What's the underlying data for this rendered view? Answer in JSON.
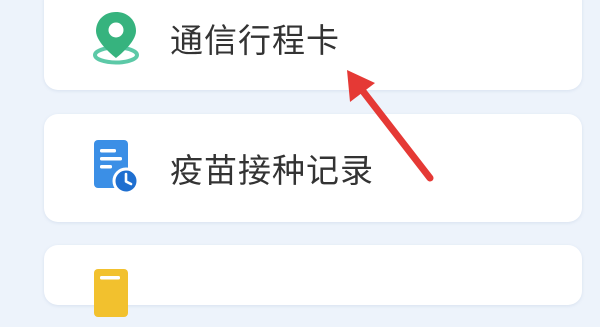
{
  "menu": {
    "items": [
      {
        "label": "通信行程卡",
        "icon": "location-pin-icon",
        "accent": "#36b37e"
      },
      {
        "label": "疫苗接种记录",
        "icon": "document-clock-icon",
        "accent": "#3b8fe6"
      },
      {
        "label": "",
        "icon": "document-icon",
        "accent": "#f2c12e"
      }
    ]
  },
  "annotation": {
    "arrow_color": "#e53935"
  }
}
